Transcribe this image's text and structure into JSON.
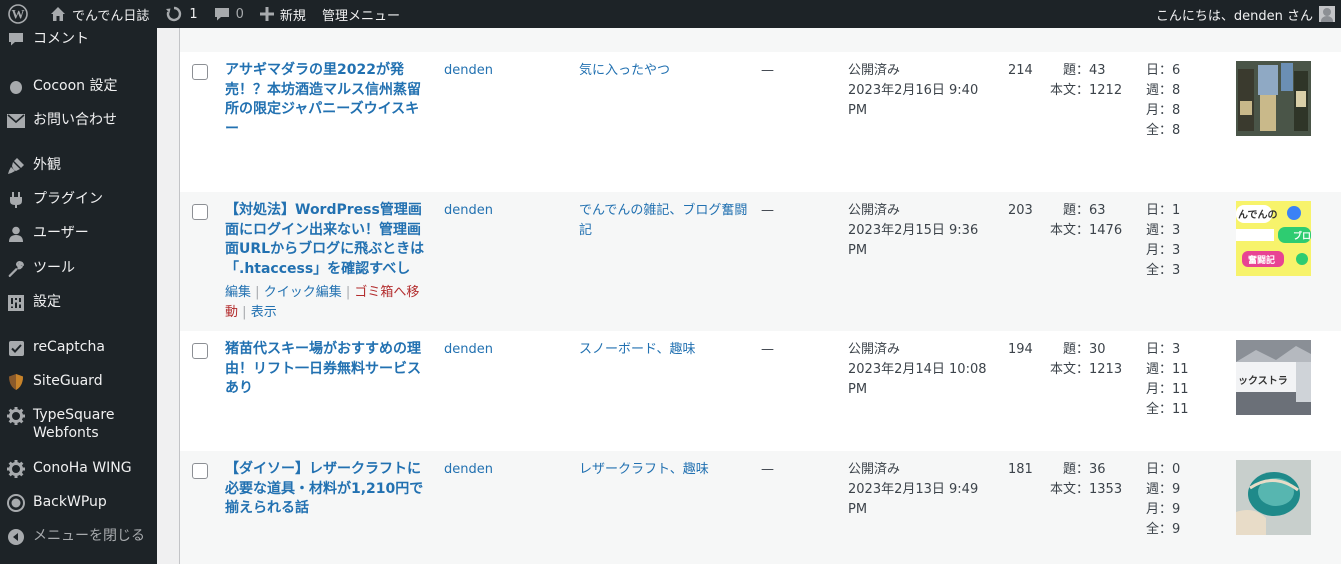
{
  "adminbar": {
    "site_name": "でんでん日誌",
    "updates_count": "1",
    "comments_count": "0",
    "new_label": "新規",
    "admin_menu_label": "管理メニュー",
    "greeting": "こんにちは、denden さん"
  },
  "sidebar": {
    "items": [
      {
        "label": "コメント",
        "icon": "comment-icon"
      },
      {
        "label": "Cocoon 設定",
        "icon": "cocoon-icon"
      },
      {
        "label": "お問い合わせ",
        "icon": "mail-icon"
      },
      {
        "label": "外観",
        "icon": "appearance-icon"
      },
      {
        "label": "プラグイン",
        "icon": "plugin-icon"
      },
      {
        "label": "ユーザー",
        "icon": "user-icon"
      },
      {
        "label": "ツール",
        "icon": "wrench-icon"
      },
      {
        "label": "設定",
        "icon": "settings-icon"
      },
      {
        "label": "reCaptcha",
        "icon": "recaptcha-icon"
      },
      {
        "label": "SiteGuard",
        "icon": "siteguard-icon"
      },
      {
        "label": "TypeSquare Webfonts",
        "icon": "gear-icon"
      },
      {
        "label": "ConoHa WING",
        "icon": "gear-icon"
      },
      {
        "label": "BackWPup",
        "icon": "backwpup-icon"
      },
      {
        "label": "メニューを閉じる",
        "icon": "collapse-icon"
      }
    ]
  },
  "posts": [
    {
      "title": "アサギマダラの里2022が発売！？本坊酒造マルス信州蒸留所の限定ジャパニーズウイスキー",
      "author": "denden",
      "categories": "気に入ったやつ",
      "tags": "—",
      "status": "公開済み",
      "date": "2023年2月16日 9:40 PM",
      "pv": "214",
      "title_chars": "題：43",
      "body_chars": "本文：1212",
      "stats": [
        "日：6",
        "週：8",
        "月：8",
        "全：8"
      ],
      "thumb_colors": [
        "#3a4a3a",
        "#8fa9c4",
        "#c9b98a",
        "#5a6b54"
      ]
    },
    {
      "title": "【対処法】WordPress管理画面にログイン出来ない！管理画面URLからブログに飛ぶときは「.htaccess」を確認すべし",
      "author": "denden",
      "categories": "でんでんの雑記、ブログ奮闘記",
      "tags": "—",
      "status": "公開済み",
      "date": "2023年2月15日 9:36 PM",
      "pv": "203",
      "title_chars": "題：63",
      "body_chars": "本文：1476",
      "stats": [
        "日：1",
        "週：3",
        "月：3",
        "全：3"
      ],
      "actions": {
        "edit": "編集",
        "quick_edit": "クイック編集",
        "trash": "ゴミ箱へ移動",
        "view": "表示",
        "sep": "|"
      },
      "thumb_text": [
        "んでんの",
        "ブロ",
        "奮闘記"
      ],
      "thumb_colors": [
        "#f7f36b",
        "#2ecc71",
        "#e84393",
        "#ffffff"
      ]
    },
    {
      "title": "猪苗代スキー場がおすすめの理由！リフト一日券無料サービスあり",
      "author": "denden",
      "categories": "スノーボード、趣味",
      "tags": "—",
      "status": "公開済み",
      "date": "2023年2月14日 10:08 PM",
      "pv": "194",
      "title_chars": "題：30",
      "body_chars": "本文：1213",
      "stats": [
        "日：3",
        "週：11",
        "月：11",
        "全：11"
      ],
      "thumb_text": [
        "ックストラ"
      ],
      "thumb_colors": [
        "#d9dde2",
        "#6b7078",
        "#f2f3f5"
      ]
    },
    {
      "title": "【ダイソー】レザークラフトに必要な道具・材料が1,210円で揃えられる話",
      "author": "denden",
      "categories": "レザークラフト、趣味",
      "tags": "—",
      "status": "公開済み",
      "date": "2023年2月13日 9:49 PM",
      "pv": "181",
      "title_chars": "題：36",
      "body_chars": "本文：1353",
      "stats": [
        "日：0",
        "週：9",
        "月：9",
        "全：9"
      ],
      "thumb_colors": [
        "#cfd6d3",
        "#1f8a8a",
        "#e8dcc8"
      ]
    }
  ]
}
